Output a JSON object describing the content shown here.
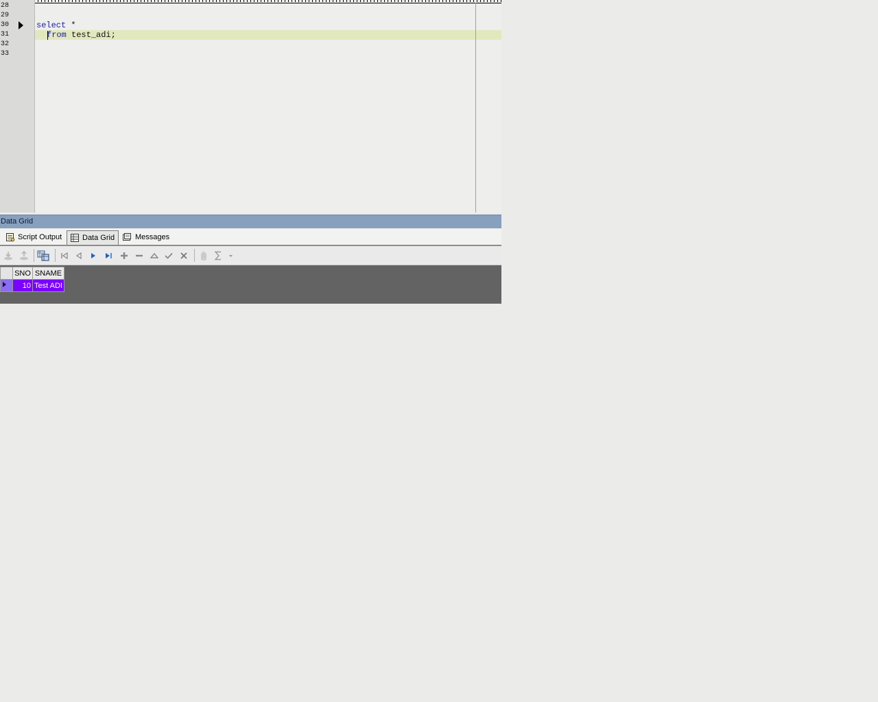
{
  "editor": {
    "line_numbers": [
      "28",
      "29",
      "30",
      "31",
      "32",
      "33"
    ],
    "code": {
      "line30_keyword": "select",
      "line30_rest": " *",
      "line31_keyword": "from",
      "line31_rest": " test_adi;"
    },
    "current_line_color": "#e2e8bd",
    "keyword_color": "#1a1aa8"
  },
  "panel": {
    "title": "Data Grid",
    "tabs": [
      {
        "label": "Script Output",
        "icon": "script-output-icon"
      },
      {
        "label": "Data Grid",
        "icon": "data-grid-icon",
        "active": true
      },
      {
        "label": "Messages",
        "icon": "messages-icon"
      }
    ],
    "toolbar": [
      "import-icon",
      "export-icon",
      "refresh-icon",
      "first-record-icon",
      "prior-record-icon",
      "next-record-icon",
      "last-record-icon",
      "insert-record-icon",
      "delete-record-icon",
      "edit-record-icon",
      "post-edit-icon",
      "cancel-edit-icon",
      "hand-icon",
      "sum-icon"
    ]
  },
  "grid": {
    "columns": [
      "SNO",
      "SNAME"
    ],
    "rows": [
      [
        "10",
        "Test ADI"
      ]
    ],
    "selection_color": "#7b00ff"
  }
}
